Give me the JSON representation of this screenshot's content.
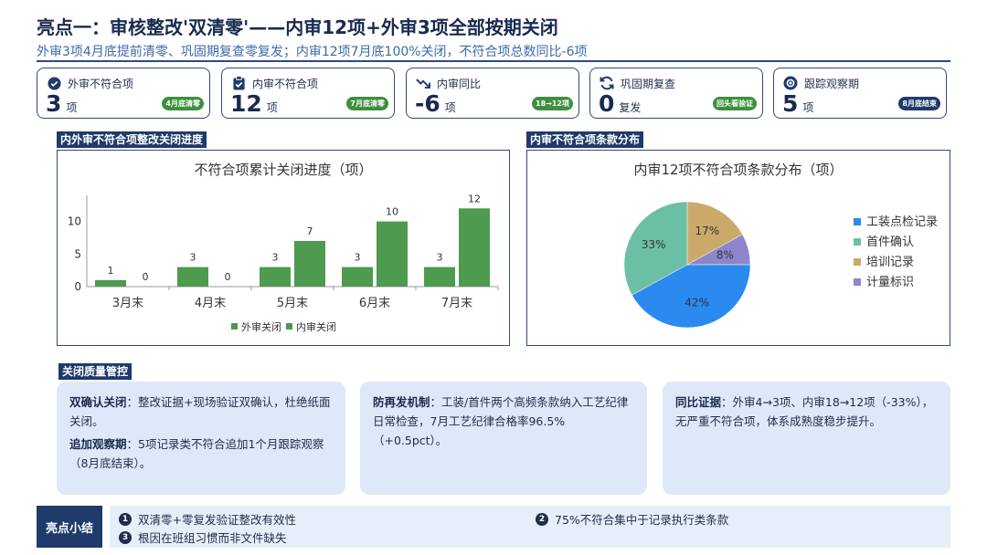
{
  "header": {
    "title": "亮点一：审核整改'双清零'——内审12项+外审3项全部按期关闭",
    "subtitle": "外审3项4月底提前清零、巩固期复查零复发；内审12项7月底100%关闭，不符合项总数同比-6项"
  },
  "kpis": [
    {
      "label": "外审不符合项",
      "value": "3",
      "unit": "项",
      "badge": "4月底清零",
      "badge_color": "#3d8f3d",
      "icon": "check-circle-icon"
    },
    {
      "label": "内审不符合项",
      "value": "12",
      "unit": "项",
      "badge": "7月底清零",
      "badge_color": "#3d8f3d",
      "icon": "clipboard-check-icon"
    },
    {
      "label": "内审同比",
      "value": "-6",
      "unit": "项",
      "badge": "18→12项",
      "badge_color": "#3d8f3d",
      "icon": "trend-down-icon"
    },
    {
      "label": "巩固期复查",
      "value": "0",
      "unit": "复发",
      "badge": "回头看验证",
      "badge_color": "#3d8f3d",
      "icon": "refresh-icon"
    },
    {
      "label": "跟踪观察期",
      "value": "5",
      "unit": "项",
      "badge": "8月底结束",
      "badge_color": "#1f3a6b",
      "icon": "eye-icon"
    }
  ],
  "sections": {
    "progress_tag": "内外审不符合项整改关闭进度",
    "distribution_tag": "内审不符合项条款分布",
    "quality_tag": "关闭质量管控"
  },
  "chart_data": [
    {
      "type": "bar",
      "title": "不符合项累计关闭进度（项）",
      "categories": [
        "3月末",
        "4月末",
        "5月末",
        "6月末",
        "7月末"
      ],
      "series": [
        {
          "name": "外审关闭",
          "values": [
            1,
            3,
            3,
            3,
            3
          ]
        },
        {
          "name": "内审关闭",
          "values": [
            0,
            0,
            7,
            10,
            12
          ]
        }
      ],
      "ylim": [
        0,
        14
      ],
      "yticks": [
        0,
        5,
        10
      ],
      "color": "#4e9a4e",
      "legend_position": "bottom"
    },
    {
      "type": "pie",
      "title": "内审12项不符合项条款分布（项）",
      "labels": [
        "工装点检记录",
        "首件确认",
        "培训记录",
        "计量标识"
      ],
      "values": [
        42,
        33,
        17,
        8
      ],
      "value_labels": [
        "42%",
        "33%",
        "17%",
        "8%"
      ],
      "colors": [
        "#2b8af0",
        "#6bbfa5",
        "#caa96b",
        "#8e86cc"
      ],
      "legend_position": "right"
    }
  ],
  "quality": [
    {
      "items": [
        {
          "bold": "双确认关闭",
          "text": "：整改证据+现场验证双确认，杜绝纸面关闭。"
        },
        {
          "bold": "追加观察期",
          "text": "：5项记录类不符合追加1个月跟踪观察（8月底结束）。"
        }
      ]
    },
    {
      "items": [
        {
          "bold": "防再发机制",
          "text": "：工装/首件两个高频条款纳入工艺纪律日常检查，7月工艺纪律合格率96.5%（+0.5pct）。"
        }
      ]
    },
    {
      "items": [
        {
          "bold": "同比证据",
          "text": "：外审4→3项、内审18→12项（-33%），无严重不符合项，体系成熟度稳步提升。"
        }
      ]
    }
  ],
  "summary": {
    "label": "亮点小结",
    "items": [
      {
        "num": "1",
        "text": "双清零+零复发验证整改有效性"
      },
      {
        "num": "2",
        "text": "75%不符合集中于记录执行类条款"
      },
      {
        "num": "3",
        "text": "根因在班组习惯而非文件缺失"
      }
    ]
  }
}
